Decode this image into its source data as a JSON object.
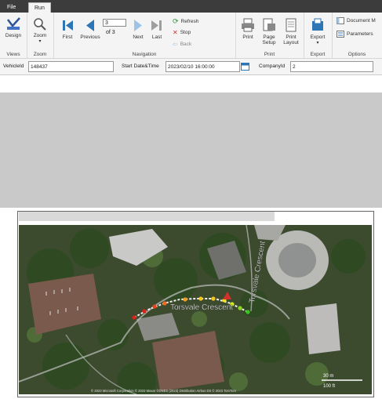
{
  "tabs": [
    {
      "label": "File"
    },
    {
      "label": "Run"
    }
  ],
  "ribbon": {
    "design": "Design",
    "zoom": "Zoom",
    "first": "First",
    "previous": "Previous",
    "current_page": "3",
    "of_pages": "of 3",
    "next": "Next",
    "last": "Last",
    "refresh": "Refresh",
    "stop": "Stop",
    "back": "Back",
    "print": "Print",
    "page_setup_1": "Page",
    "page_setup_2": "Setup",
    "print_layout_1": "Print",
    "print_layout_2": "Layout",
    "export": "Export",
    "document_map": "Document M",
    "parameters": "Parameters",
    "groups": {
      "views": "Views",
      "zoom": "Zoom",
      "navigation": "Navigation",
      "print": "Print",
      "export": "Export",
      "options": "Options"
    }
  },
  "params": {
    "vehicle_label": "VehicleId",
    "vehicle_value": "148437",
    "start_label": "Start Date&Time",
    "start_value": "2023/02/10 16:00:00",
    "company_label": "CompanyId",
    "company_value": "2"
  },
  "map": {
    "street_1": "Torsvale Crescent",
    "street_2": "Torsvale Crescent",
    "scale_top": "30 m",
    "scale_bottom": "100 ft",
    "copyright": "© 2023 Microsoft Corporation © 2023 Maxar ©CNES (2023) Distribution Airbus DS © 2023 TomTom",
    "track_colors": [
      "#e0201b",
      "#e8431a",
      "#ef6a1a",
      "#f39c1a",
      "#f6c51a",
      "#f3e21a",
      "#d4ec1a",
      "#8bd71c",
      "#39c51e"
    ]
  }
}
